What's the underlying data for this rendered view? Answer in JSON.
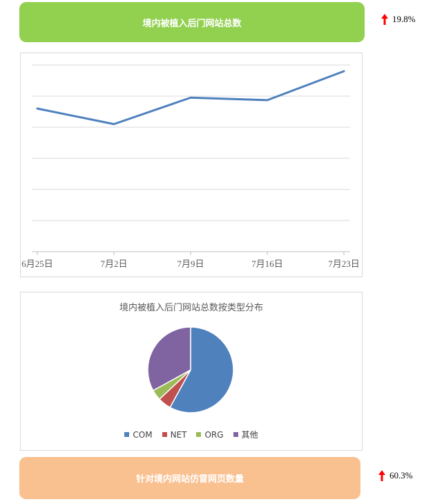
{
  "top_banner": {
    "title": "境内被植入后门网站总数",
    "change": "19.8%",
    "color": "#92d050"
  },
  "bottom_banner": {
    "title": "针对境内网站仿冒网页数量",
    "change": "60.3%",
    "color": "#f9c090"
  },
  "chart_data": [
    {
      "type": "line",
      "categories": [
        "6月25日",
        "7月2日",
        "7月9日",
        "7月16日",
        "7月23日"
      ],
      "series": [
        {
          "values": [
            4.6,
            4.1,
            4.95,
            4.87,
            5.8
          ],
          "color": "#4f81bd"
        }
      ],
      "ylim": [
        0,
        6
      ],
      "grid": true
    },
    {
      "type": "pie",
      "title": "境内被植入后门网站总数按类型分布",
      "legend_position": "bottom",
      "slices": [
        {
          "label": "COM",
          "value": 58,
          "color": "#4f81bd"
        },
        {
          "label": "NET",
          "value": 5,
          "color": "#c0504d"
        },
        {
          "label": "ORG",
          "value": 4,
          "color": "#9bbb59"
        },
        {
          "label": "其他",
          "value": 33,
          "color": "#8064a2"
        }
      ]
    }
  ]
}
